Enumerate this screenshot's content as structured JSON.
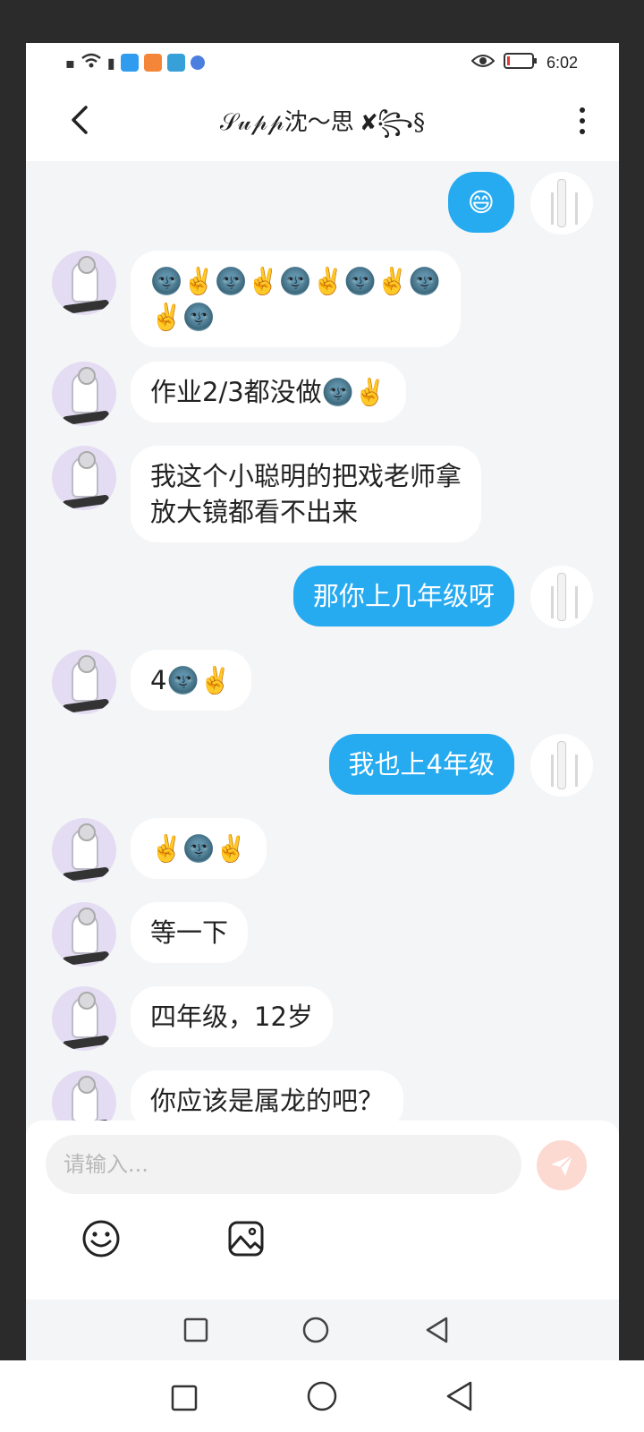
{
  "status_bar": {
    "time": "6:02"
  },
  "header": {
    "title": "𝒮𝓊𝓅𝓅沈～思 ✘꧂§"
  },
  "messages": [
    {
      "side": "out",
      "text": "😄"
    },
    {
      "side": "in",
      "text": "🌚✌️🌚✌️🌚✌️🌚✌️🌚\n✌️🌚"
    },
    {
      "side": "in",
      "text": "作业2/3都没做🌚✌️"
    },
    {
      "side": "in",
      "text": "我这个小聪明的把戏老师拿\n放大镜都看不出来"
    },
    {
      "side": "out",
      "text": "那你上几年级呀"
    },
    {
      "side": "in",
      "text": "4🌚✌️"
    },
    {
      "side": "out",
      "text": "我也上4年级"
    },
    {
      "side": "in",
      "text": "✌️🌚✌️"
    },
    {
      "side": "in",
      "text": "等一下"
    },
    {
      "side": "in",
      "text": "四年级，12岁"
    },
    {
      "side": "in",
      "text": "你应该是属龙的吧？"
    }
  ],
  "composer": {
    "placeholder": "请输入..."
  },
  "icons": {
    "back": "chevron-left-icon",
    "more": "more-vertical-icon",
    "send": "send-icon",
    "emoji": "emoji-icon",
    "image": "image-icon",
    "nav_recent": "square-icon",
    "nav_home": "circle-icon",
    "nav_back": "triangle-back-icon"
  },
  "colors": {
    "outgoing_bubble": "#26aaf0",
    "incoming_bubble": "#ffffff",
    "chat_background": "#f4f5f7",
    "send_button": "#fcd9d1",
    "avatar_background": "#e4dcf2"
  }
}
